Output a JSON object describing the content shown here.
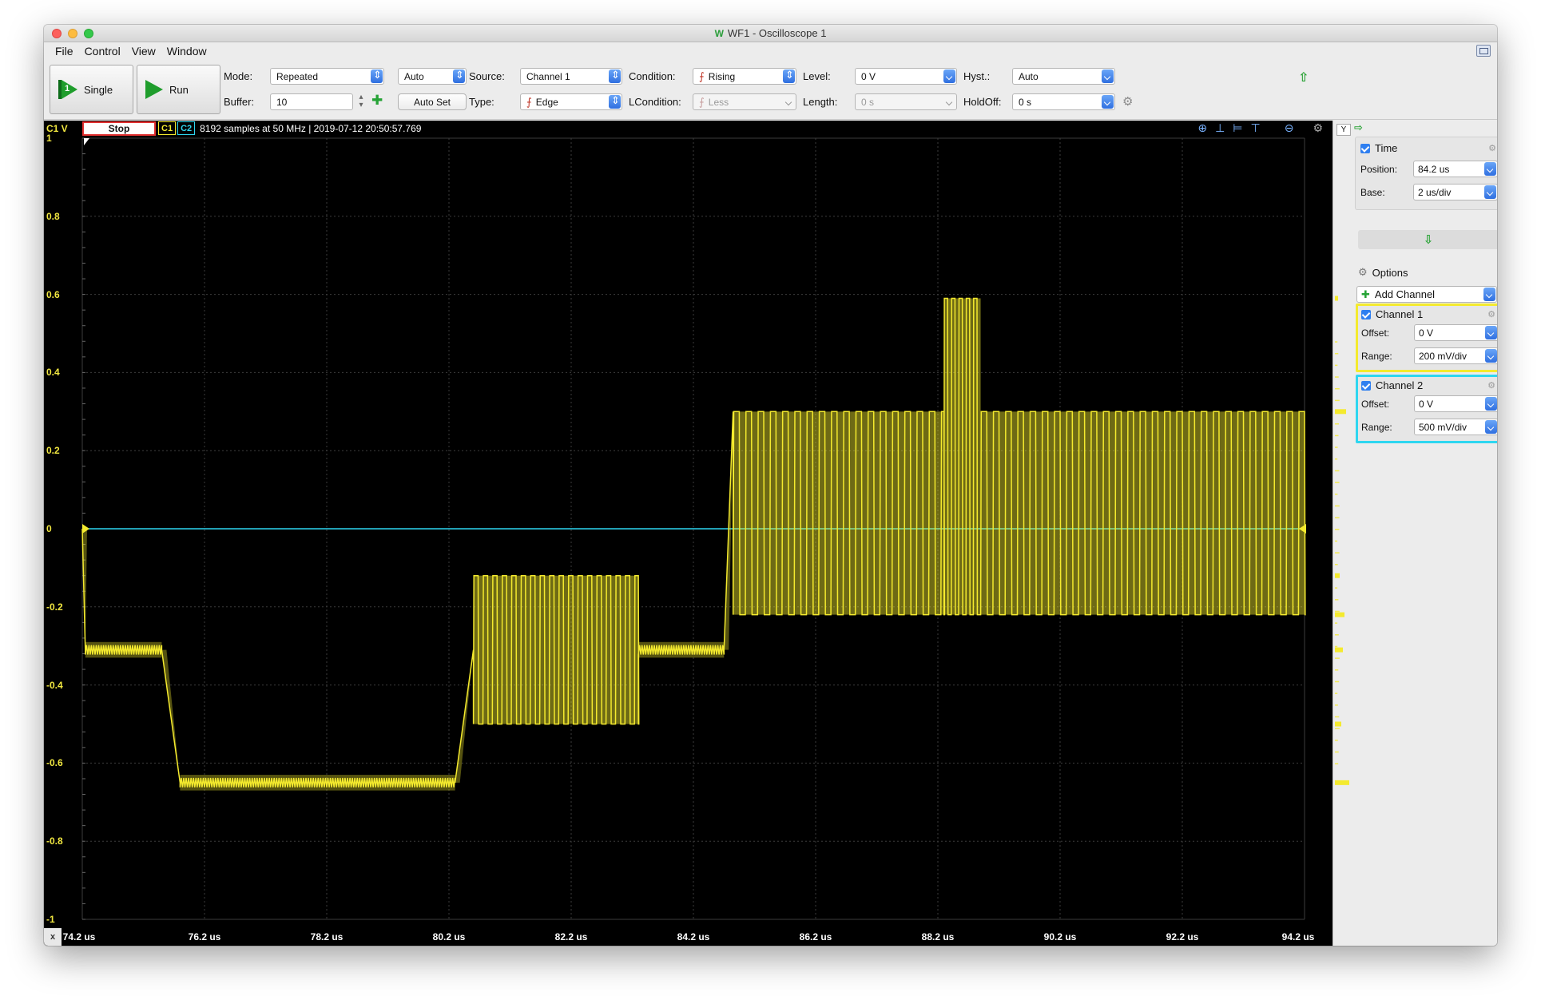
{
  "window": {
    "title": "WF1 - Oscilloscope 1",
    "app_icon": "waveforms-icon"
  },
  "menu": [
    "File",
    "Control",
    "View",
    "Window"
  ],
  "toolbar": {
    "single_label": "Single",
    "run_label": "Run",
    "mode_label": "Mode:",
    "mode_value": "Repeated",
    "auto_value": "Auto",
    "buffer_label": "Buffer:",
    "buffer_value": "10",
    "autoset_label": "Auto Set",
    "source_label": "Source:",
    "source_value": "Channel 1",
    "type_label": "Type:",
    "type_value": "Edge",
    "condition_label": "Condition:",
    "condition_value": "Rising",
    "lcondition_label": "LCondition:",
    "lcondition_value": "Less",
    "level_label": "Level:",
    "level_value": "0 V",
    "length_label": "Length:",
    "length_value": "0 s",
    "hyst_label": "Hyst.:",
    "hyst_value": "Auto",
    "holdoff_label": "HoldOff:",
    "holdoff_value": "0 s"
  },
  "scope": {
    "axis_unit_label": "C1 V",
    "stop_label": "Stop",
    "ch1_tag": "C1",
    "ch2_tag": "C2",
    "info": "8192 samples at 50 MHz | 2019-07-12 20:50:57.769",
    "x_button": "x",
    "ch1_color": "#f4ea2e",
    "ch2_color": "#2ed6f0"
  },
  "chart_data": {
    "type": "line",
    "title": "",
    "xlabel": "",
    "ylabel": "C1 V",
    "xlim": [
      74.2,
      94.2
    ],
    "ylim": [
      -1,
      1
    ],
    "x_ticks": [
      "74.2 us",
      "76.2 us",
      "78.2 us",
      "80.2 us",
      "82.2 us",
      "84.2 us",
      "86.2 us",
      "88.2 us",
      "90.2 us",
      "92.2 us",
      "94.2 us"
    ],
    "y_ticks": [
      "1",
      "0.8",
      "0.6",
      "0.4",
      "0.2",
      "0",
      "-0.2",
      "-0.4",
      "-0.6",
      "-0.8",
      "-1"
    ],
    "grid": true,
    "series": [
      {
        "name": "C1",
        "segments": [
          {
            "x": [
              74.2,
              74.25
            ],
            "kind": "drop",
            "from": 0.0,
            "to": -0.31
          },
          {
            "x": [
              74.25,
              75.5
            ],
            "kind": "flat",
            "level": -0.31
          },
          {
            "x": [
              75.5,
              75.8
            ],
            "kind": "drop",
            "from": -0.31,
            "to": -0.65
          },
          {
            "x": [
              75.8,
              80.3
            ],
            "kind": "flat",
            "level": -0.65
          },
          {
            "x": [
              80.3,
              80.6
            ],
            "kind": "rise",
            "from": -0.65,
            "to": -0.31
          },
          {
            "x": [
              80.6,
              83.3
            ],
            "kind": "osc",
            "high": -0.12,
            "low": -0.5,
            "period": 0.155
          },
          {
            "x": [
              83.3,
              84.7
            ],
            "kind": "flat",
            "level": -0.31
          },
          {
            "x": [
              84.7,
              84.85
            ],
            "kind": "rise",
            "from": -0.31,
            "to": 0.3
          },
          {
            "x": [
              84.85,
              88.3
            ],
            "kind": "osc",
            "high": 0.3,
            "low": -0.22,
            "period": 0.2
          },
          {
            "x": [
              88.3,
              88.9
            ],
            "kind": "osc",
            "high": 0.59,
            "low": -0.22,
            "period": 0.12
          },
          {
            "x": [
              88.9,
              94.2
            ],
            "kind": "osc",
            "high": 0.3,
            "low": -0.22,
            "period": 0.2
          }
        ]
      },
      {
        "name": "C2",
        "constant": 0.0
      }
    ]
  },
  "side": {
    "time_label": "Time",
    "position_label": "Position:",
    "position_value": "84.2 us",
    "base_label": "Base:",
    "base_value": "2 us/div",
    "options_label": "Options",
    "add_channel_label": "Add Channel",
    "ch1_label": "Channel 1",
    "ch1_offset_label": "Offset:",
    "ch1_offset_value": "0 V",
    "ch1_range_label": "Range:",
    "ch1_range_value": "200 mV/div",
    "ch2_label": "Channel 2",
    "ch2_offset_label": "Offset:",
    "ch2_offset_value": "0 V",
    "ch2_range_label": "Range:",
    "ch2_range_value": "500 mV/div",
    "y_button": "Y"
  }
}
